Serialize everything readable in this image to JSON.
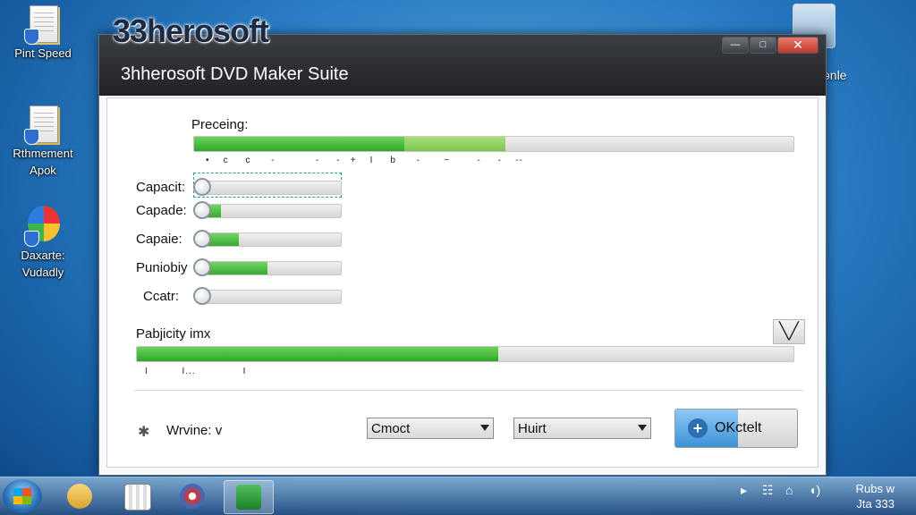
{
  "desktop": {
    "icons": [
      {
        "label_line1": "Pint Speed",
        "label_line2": ""
      },
      {
        "label_line1": "Rthmement",
        "label_line2": "Apok"
      },
      {
        "label_line1": "Daxarte:",
        "label_line2": "Vudadly"
      }
    ],
    "right_icon_label": "ənle"
  },
  "brand_text": "33herosoft",
  "window": {
    "title": "3hherosoft DVD Maker Suite",
    "controls": {
      "minimize": "—",
      "maximize": "□",
      "close": "✕"
    }
  },
  "processing": {
    "label": "Preceing:",
    "progress_primary": 0.35,
    "progress_secondary": 0.52,
    "ticks": "•    c     c      -            -     -   +    I     b      -       ~        -     -    --"
  },
  "sliders": [
    {
      "label": "Capacit:",
      "value": 0.0,
      "selected": true
    },
    {
      "label": "Capade:",
      "value": 0.15,
      "selected": false
    },
    {
      "label": "Capaie:",
      "value": 0.28,
      "selected": false
    },
    {
      "label": "Puniobiy",
      "value": 0.48,
      "selected": false
    },
    {
      "label": "Ccatr:",
      "value": 0.0,
      "selected": false
    }
  ],
  "capacity": {
    "label": "Pabjicity imx",
    "progress": 0.55,
    "ticks": "I          I...              I",
    "collapse_icon": "╲╱"
  },
  "bottom": {
    "gear_glyph": "✱",
    "label": "Wrvine: v",
    "select1": "Cmoct",
    "select2": "Huirt",
    "ok_label": "OKctelt",
    "ok_plus": "+"
  },
  "taskbar": {
    "tray_glyphs": [
      "▸",
      "☷",
      "⌂",
      "◖)"
    ],
    "clock_line1": "Rubs w",
    "clock_line2": "Jta 333"
  },
  "colors": {
    "progress_green": "#2fa72c",
    "progress_light_green": "#7cc44e",
    "title_bar": "#202226",
    "accent_blue": "#3c91d6"
  }
}
